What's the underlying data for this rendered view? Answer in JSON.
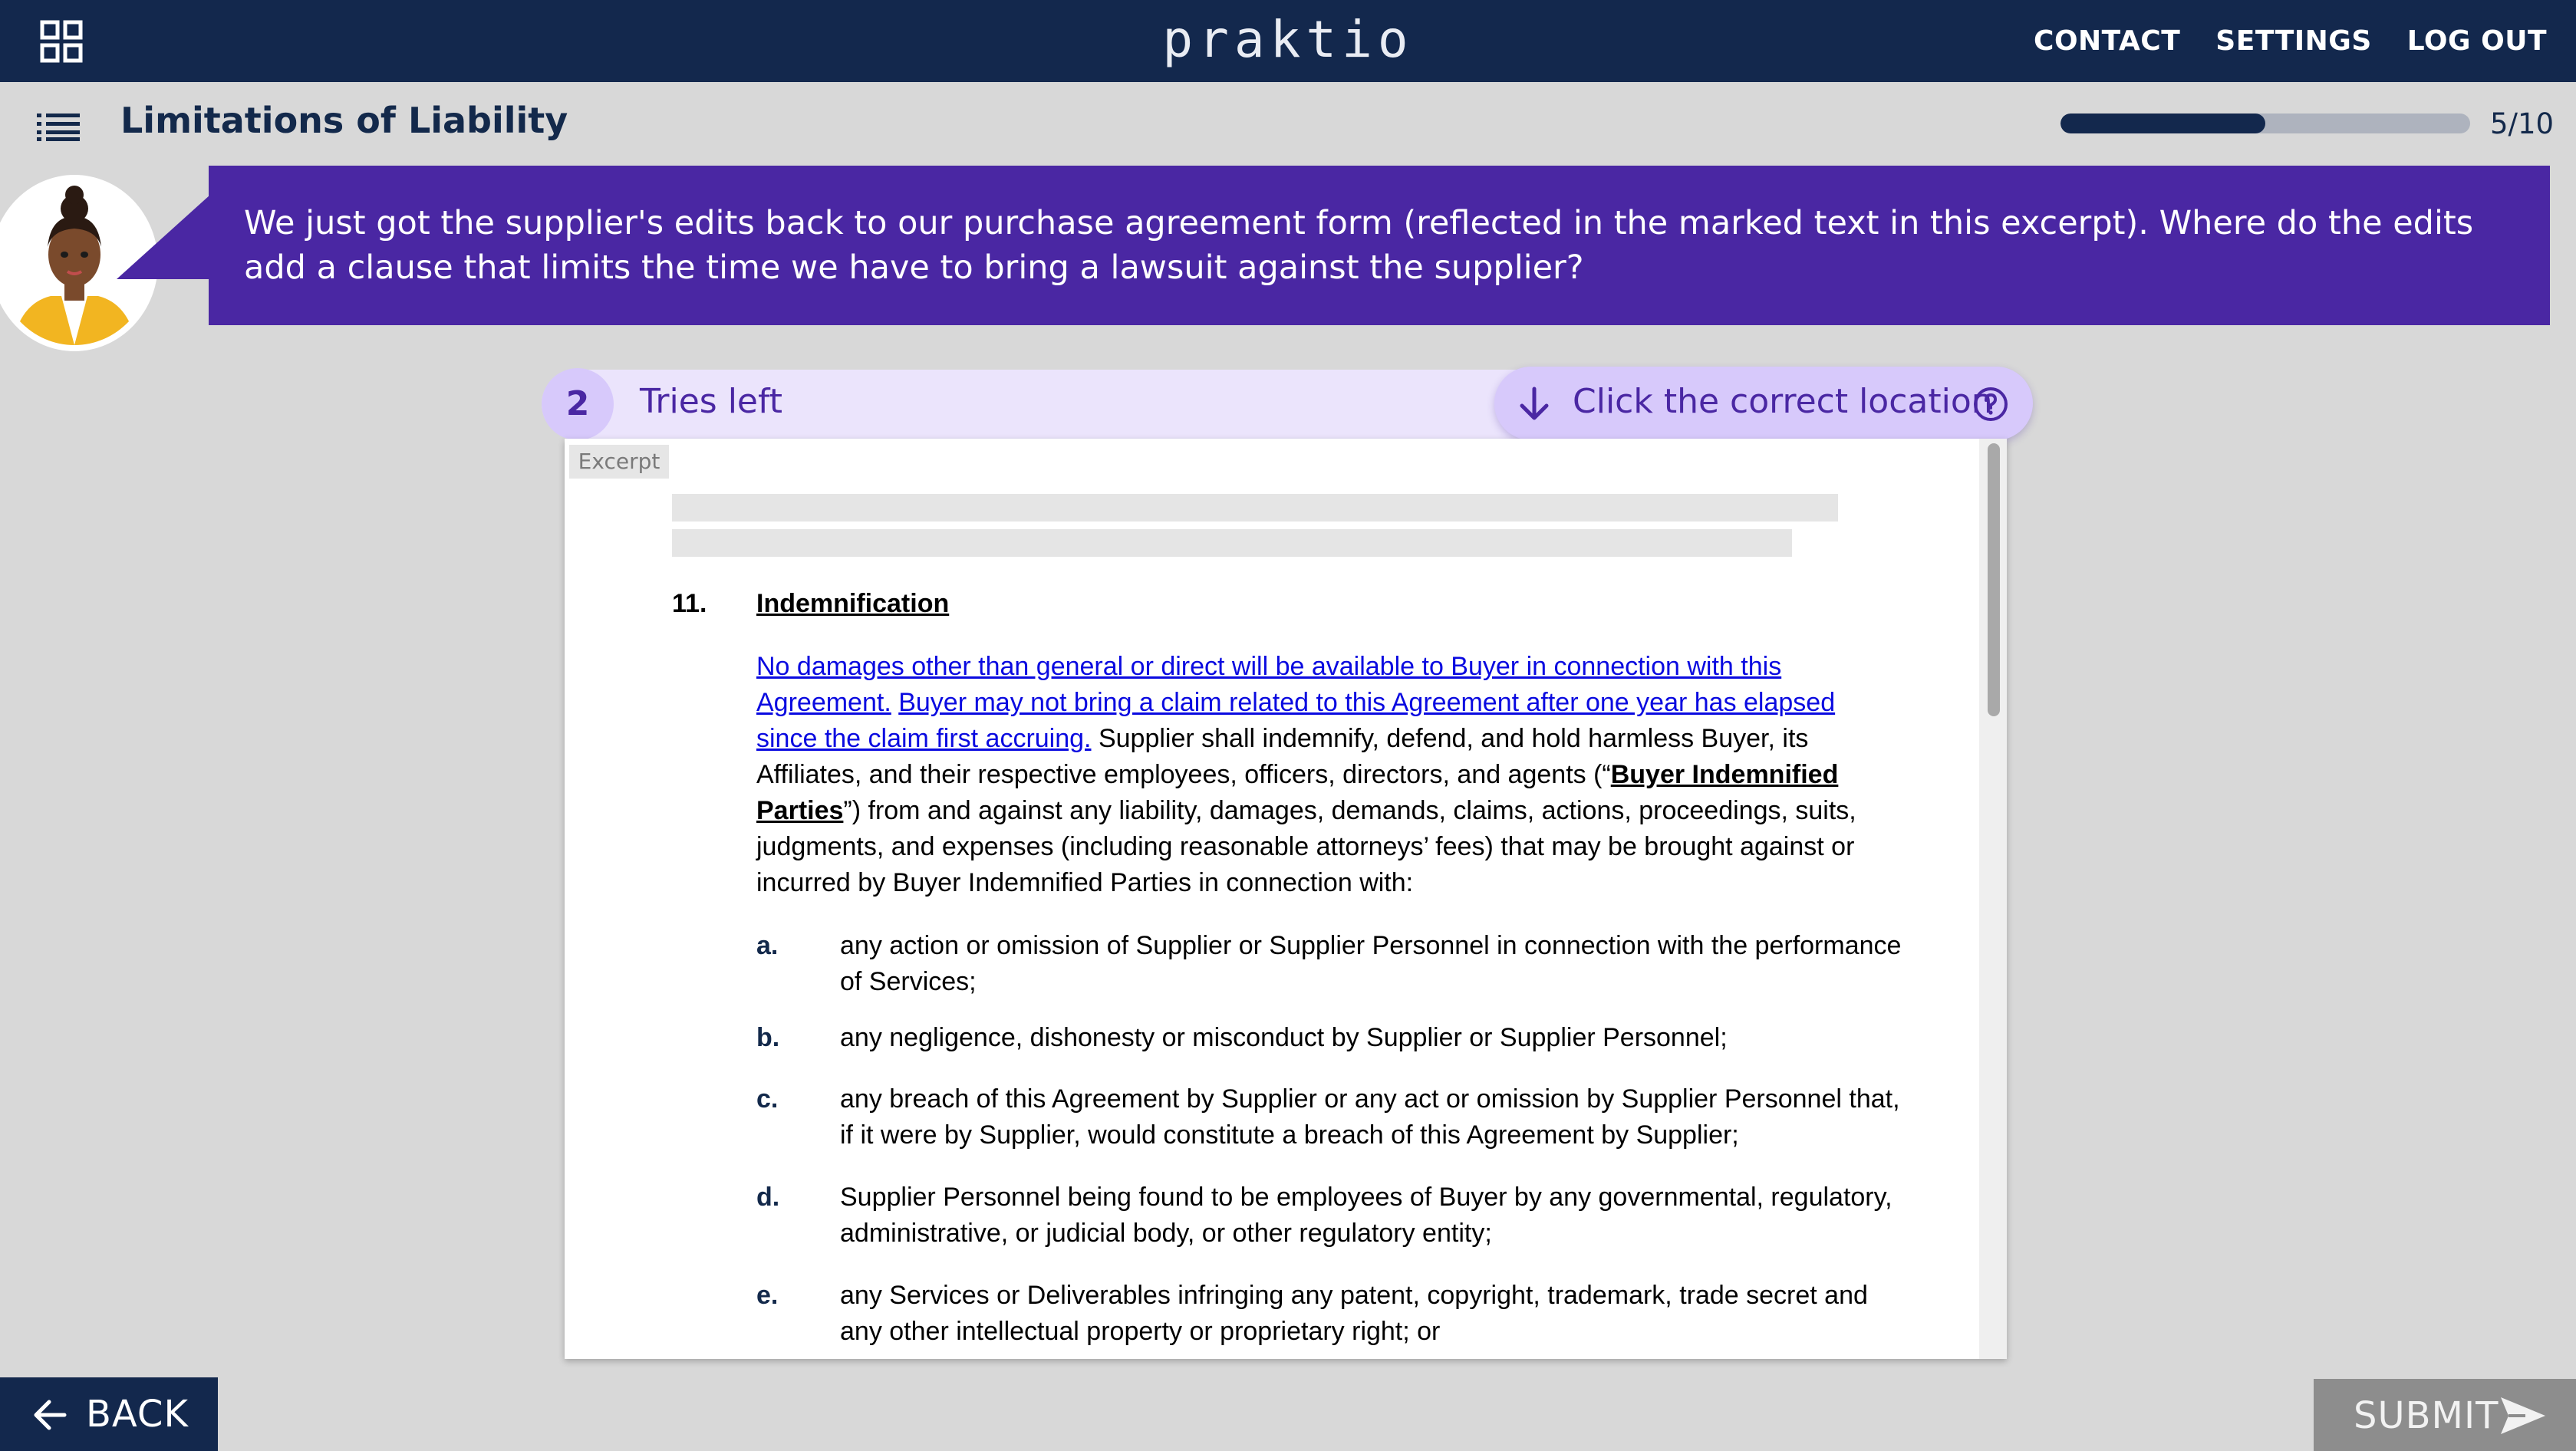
{
  "header": {
    "brand": "praktio",
    "nav": [
      "CONTACT",
      "SETTINGS",
      "LOG OUT"
    ]
  },
  "lesson": {
    "title": "Limitations of Liability",
    "progress_text": "5/10",
    "progress_fraction": 0.5
  },
  "prompt": {
    "text": "We just got the supplier's edits back to our purchase agreement form (reflected in the marked text in this excerpt). Where do the edits add a clause that limits the time we have to bring a lawsuit against the supplier?"
  },
  "task": {
    "tries_count": "2",
    "tries_label": "Tries left",
    "instruction": "Click the correct location"
  },
  "document": {
    "tag": "Excerpt",
    "section_number": "11.",
    "section_title": "Indemnification",
    "edit_sentence_1": "No damages other than general or direct will be available to Buyer in connection with this Agreement.",
    "edit_sentence_2": "Buyer may not bring a claim related to this Agreement after one year has elapsed since the claim first accruing.",
    "para_before_defined": "Supplier shall indemnify, defend, and hold harmless Buyer, its Affiliates, and their respective employees, officers, directors, and agents (“",
    "defined_term": "Buyer Indemnified Parties",
    "para_after_defined": "”) from and against any liability, damages, demands, claims, actions, proceedings, suits, judgments, and expenses (including reasonable attorneys’ fees) that may be brought against or incurred by Buyer Indemnified Parties in connection with:",
    "items": [
      {
        "letter": "a.",
        "text": "any action or omission of Supplier or Supplier Personnel in connection with the performance of Services;"
      },
      {
        "letter": "b.",
        "text": "any negligence, dishonesty or misconduct by Supplier or Supplier Personnel;"
      },
      {
        "letter": "c.",
        "text": "any breach of this Agreement by Supplier or any act or omission by Supplier Personnel that, if it were by Supplier, would constitute a breach of this Agreement by Supplier;"
      },
      {
        "letter": "d.",
        "text": "Supplier Personnel being found to be employees of Buyer by any governmental, regulatory, administrative, or judicial body, or other regulatory entity;"
      },
      {
        "letter": "e.",
        "text": "any Services or Deliverables infringing any patent, copyright, trademark, trade secret and any other intellectual property or proprietary right; or"
      }
    ]
  },
  "footer": {
    "back_label": "BACK",
    "submit_label": "SUBMIT"
  },
  "colors": {
    "navy": "#13284d",
    "purple": "#4a27a3",
    "lavender": "#ebe4fc",
    "link_blue": "#0a0ae0",
    "background": "#d8d8d8"
  },
  "icons": [
    "apps-grid-icon",
    "list-icon",
    "arrow-down-icon",
    "help-icon",
    "back-arrow-icon",
    "send-icon",
    "avatar"
  ]
}
